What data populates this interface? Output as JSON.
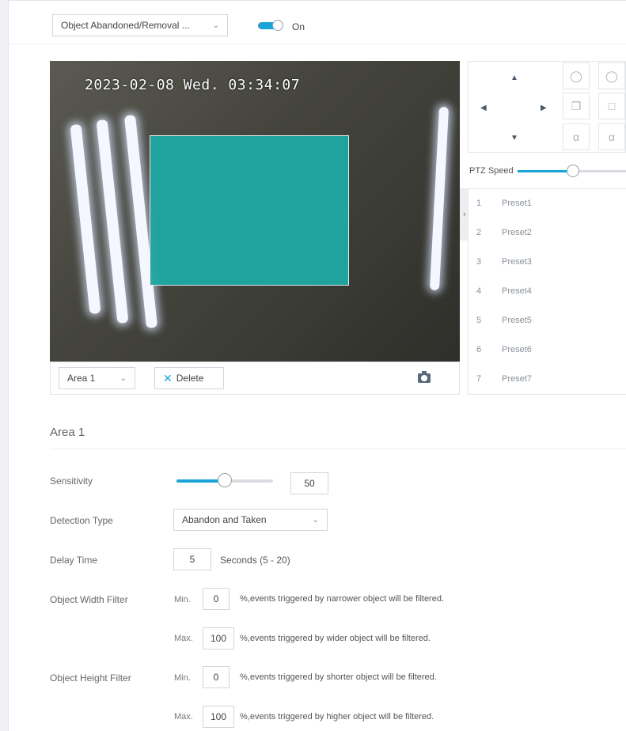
{
  "header": {
    "detection_select": "Object Abandoned/Removal ...",
    "toggle_label": "On"
  },
  "video": {
    "osd_timestamp": "2023-02-08 Wed. 03:34:07",
    "area_select": "Area 1",
    "delete_label": "Delete"
  },
  "ptz": {
    "speed_label": "PTZ Speed",
    "speed_level": 0.5,
    "presets": [
      {
        "num": "1",
        "name": "Preset1"
      },
      {
        "num": "2",
        "name": "Preset2"
      },
      {
        "num": "3",
        "name": "Preset3"
      },
      {
        "num": "4",
        "name": "Preset4"
      },
      {
        "num": "5",
        "name": "Preset5"
      },
      {
        "num": "6",
        "name": "Preset6"
      },
      {
        "num": "7",
        "name": "Preset7"
      }
    ]
  },
  "area": {
    "title": "Area 1",
    "sensitivity_label": "Sensitivity",
    "sensitivity_value": "50",
    "detection_type_label": "Detection Type",
    "detection_type_value": "Abandon and Taken",
    "delay_label": "Delay Time",
    "delay_value": "5",
    "delay_hint": "Seconds (5 - 20)",
    "width_filter_label": "Object Width Filter",
    "width_min_label": "Min.",
    "width_min_value": "0",
    "width_min_hint": "%,events triggered by narrower object will be filtered.",
    "width_max_label": "Max.",
    "width_max_value": "100",
    "width_max_hint": "%,events triggered by wider object will be filtered.",
    "height_filter_label": "Object Height Filter",
    "height_min_label": "Min.",
    "height_min_value": "0",
    "height_min_hint": "%,events triggered by shorter object will be filtered.",
    "height_max_label": "Max.",
    "height_max_value": "100",
    "height_max_hint": "%,events triggered by higher object will be filtered."
  },
  "colors": {
    "accent": "#1ba4d8",
    "roi": "#1fa8a4"
  }
}
